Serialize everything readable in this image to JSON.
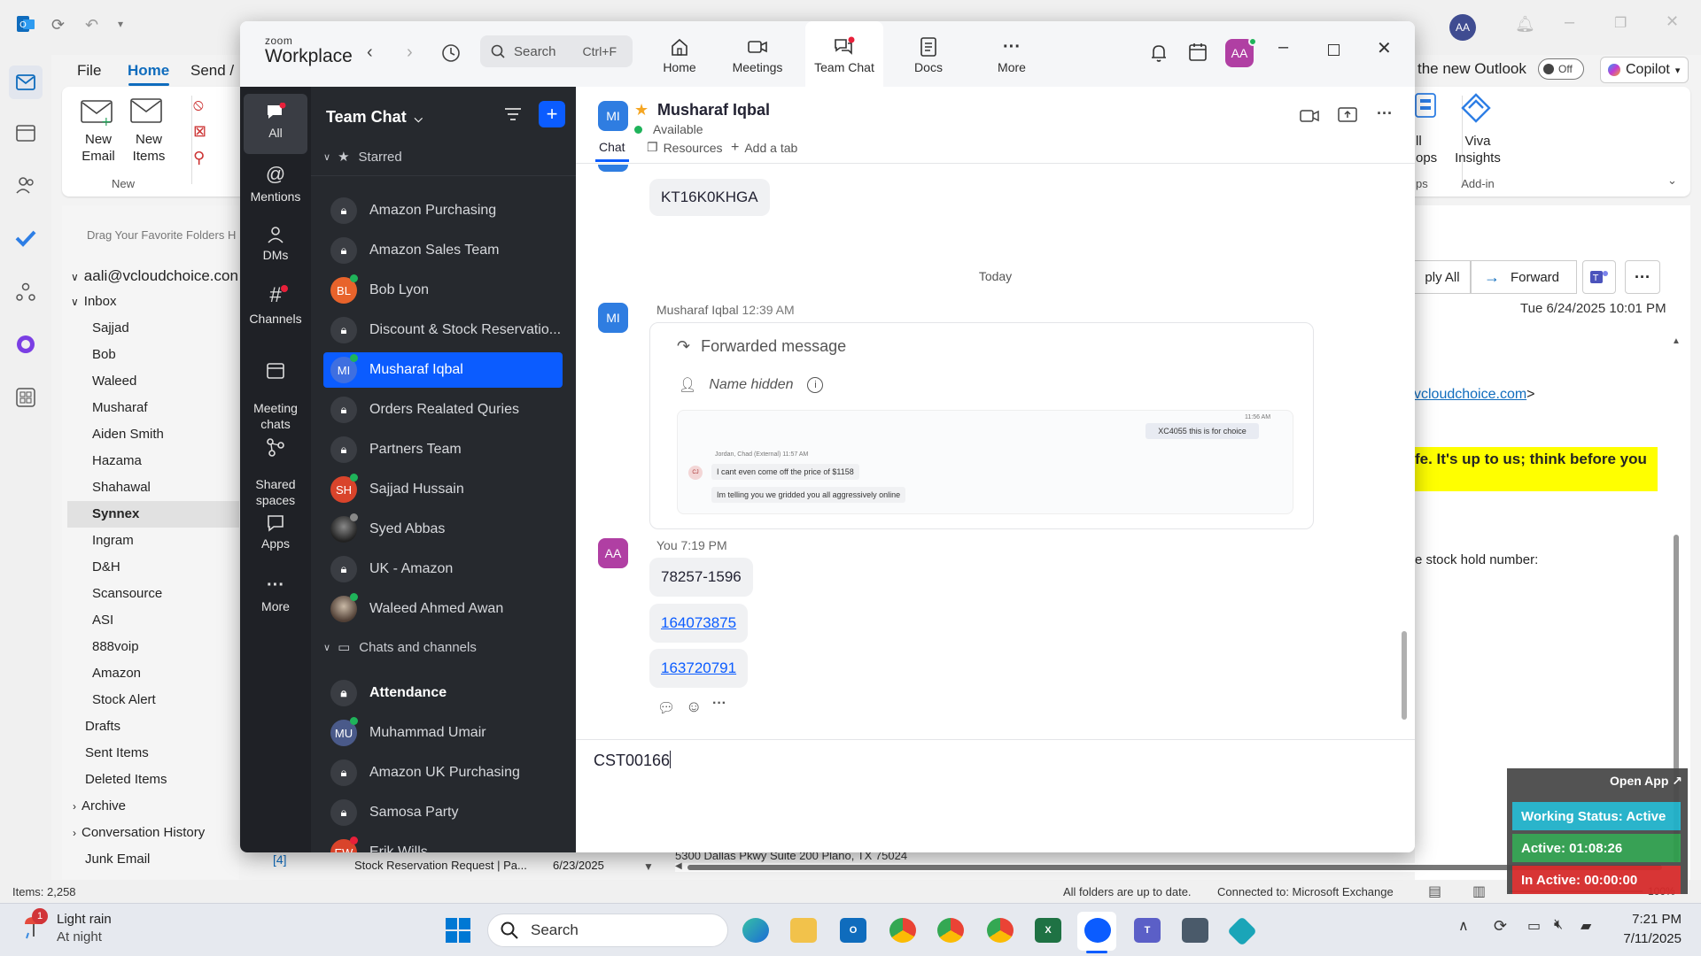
{
  "outlook": {
    "ribbon_tabs": [
      "File",
      "Home",
      "Send /"
    ],
    "new_email_label": "New\nEmail",
    "new_items_label": "New\nItems",
    "group_new": "New",
    "new_outlook_label": "the new Outlook",
    "toggle_label": "Off",
    "copilot_label": "Copilot",
    "all_apps_label": "ll\nops",
    "viva_label": "Viva\nInsights",
    "addin_group": "Add-in",
    "apps_group": "ps",
    "drag_hint": "Drag Your Favorite Folders H",
    "account": "aali@vcloudchoice.con",
    "inbox": "Inbox",
    "subfolders": [
      "Sajjad",
      "Bob",
      "Waleed",
      "Musharaf",
      "Aiden Smith",
      "Hazama",
      "Shahawal",
      "Synnex",
      "Ingram",
      "D&H",
      "Scansource",
      "ASI",
      "888voip",
      "Amazon",
      "Stock Alert"
    ],
    "folders": [
      "Drafts",
      "Sent Items",
      "Deleted Items"
    ],
    "archive": "Archive",
    "conversation_history": "Conversation History",
    "junk": "Junk Email",
    "junk_count": "[4]",
    "reply_all": "ply All",
    "forward": "Forward",
    "date": "Tue 6/24/2025 10:01 PM",
    "email_link": "vcloudchoice.com",
    "email_link_suffix": ">",
    "highlight_text": "fe. It's up to us; think before you",
    "body_text": "e stock hold number:",
    "list_subject": "Stock Reservation Request | Pa...",
    "list_date": "6/23/2025",
    "address_text": "5300 Dallas Pkwy Suite 200 Plano, TX 75024",
    "items_count": "Items: 2,258",
    "status_folders": "All folders are up to date.",
    "status_connected": "Connected to: Microsoft Exchange",
    "zoom_percent": "100%"
  },
  "zoom": {
    "logo_top": "zoom",
    "logo_bottom": "Workplace",
    "search_placeholder": "Search",
    "search_shortcut": "Ctrl+F",
    "nav": [
      "Home",
      "Meetings",
      "Team Chat",
      "Docs",
      "More"
    ],
    "avatar_initials": "AA",
    "rail": [
      "All",
      "Mentions",
      "DMs",
      "Channels",
      "Meeting\nchats",
      "Shared\nspaces",
      "Apps",
      "More"
    ],
    "list_title": "Team Chat",
    "starred_label": "Starred",
    "starred": [
      {
        "name": "Amazon Purchasing",
        "type": "lock"
      },
      {
        "name": "Amazon Sales Team",
        "type": "lock"
      },
      {
        "name": "Bob Lyon",
        "type": "avatar",
        "initials": "BL",
        "color": "#e8632b"
      },
      {
        "name": "Discount & Stock Reservatio...",
        "type": "lock"
      },
      {
        "name": "Musharaf Iqbal",
        "type": "avatar",
        "initials": "MI",
        "color": "#2f7de1"
      },
      {
        "name": "Orders Realated Quries",
        "type": "lock"
      },
      {
        "name": "Partners Team",
        "type": "lock"
      },
      {
        "name": "Sajjad Hussain",
        "type": "avatar",
        "initials": "SH",
        "color": "#d9442b"
      },
      {
        "name": "Syed Abbas",
        "type": "photo"
      },
      {
        "name": "UK - Amazon",
        "type": "lock"
      },
      {
        "name": "Waleed Ahmed Awan",
        "type": "photo"
      }
    ],
    "chats_label": "Chats and channels",
    "chats": [
      {
        "name": "Attendance",
        "type": "lock"
      },
      {
        "name": "Muhammad Umair",
        "type": "avatar",
        "initials": "MU",
        "color": "#4a5a8a"
      },
      {
        "name": "Amazon UK Purchasing",
        "type": "lock"
      },
      {
        "name": "Samosa Party",
        "type": "lock"
      },
      {
        "name": "Erik Wills",
        "type": "avatar",
        "initials": "EW",
        "color": "#d9442b"
      }
    ],
    "contact": {
      "initials": "MI",
      "name": "Musharaf Iqbal",
      "status": "Available"
    },
    "tabs": [
      "Chat",
      "Resources",
      "Add a tab"
    ],
    "prev_message": "KT16K0KHGA",
    "today": "Today",
    "msg1": {
      "sender": "Musharaf Iqbal",
      "time": "12:39 AM",
      "forwarded": "Forwarded message",
      "name_hidden": "Name hidden",
      "inner_time1": "11:56 AM",
      "inner_msg1": "XC4055   this is for choice",
      "inner_sender": "Jordan, Chad (External)  11:57 AM",
      "inner_initials": "CJ",
      "inner_msg2": "I cant even come off the price of $1158",
      "inner_msg3": "Im telling you we gridded you all aggressively online"
    },
    "msg2": {
      "sender": "You",
      "time": "7:19 PM",
      "initials": "AA",
      "lines": [
        "78257-1596",
        "164073875",
        "163720791"
      ]
    },
    "compose_text": "CST00166"
  },
  "tracker": {
    "open_app": "Open App ↗",
    "working_status": "Working Status: Active",
    "active": "Active: 01:08:26",
    "inactive": "In Active: 00:00:00"
  },
  "taskbar": {
    "weather_title": "Light rain",
    "weather_sub": "At night",
    "weather_badge": "1",
    "search": "Search",
    "time": "7:21 PM",
    "date": "7/11/2025"
  }
}
